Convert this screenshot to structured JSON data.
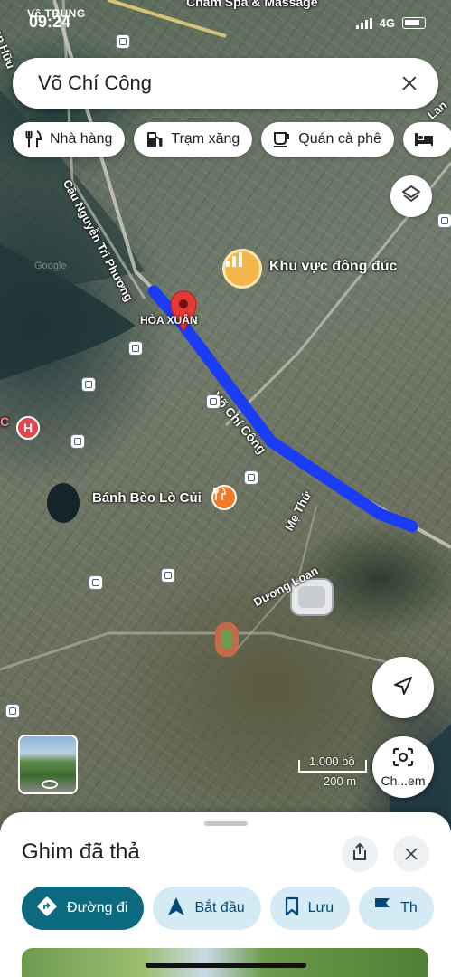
{
  "status_bar": {
    "carrier": "Về TRUNG",
    "time": "09:24",
    "network": "4G"
  },
  "search": {
    "query": "Võ Chí Công"
  },
  "chips": [
    {
      "label": "Nhà hàng",
      "icon": "fork-knife-icon"
    },
    {
      "label": "Trạm xăng",
      "icon": "gas-pump-icon"
    },
    {
      "label": "Quán cà phê",
      "icon": "coffee-icon"
    },
    {
      "label": "",
      "icon": "bed-icon"
    }
  ],
  "map": {
    "top_label": "Chăm Spa & Massage",
    "busy_area": "Khu vực đông đúc",
    "bridge_label": "Cầu Nguyễn Tri Phương",
    "district": "HÒA XUÂN",
    "street_main": "Võ Chí Công",
    "restaurant": "Bánh Bèo Lò Củi",
    "street_me_thu": "Mẹ Thứ",
    "street_duong_loan": "Dương Loan",
    "left_edge_label": "en Hữu",
    "right_edge_label": "Lan",
    "left_c": "C",
    "watermark": "Google",
    "route_color": "#1a3cf5",
    "pin_color": "#e53935"
  },
  "scale": {
    "imperial": "1.000 bộ",
    "metric": "200 m"
  },
  "lens_button": {
    "label": "Ch...em"
  },
  "sheet": {
    "title": "Ghim đã thả",
    "actions": [
      {
        "label": "Đường đi",
        "icon": "directions-icon"
      },
      {
        "label": "Bắt đầu",
        "icon": "navigation-arrow-icon"
      },
      {
        "label": "Lưu",
        "icon": "bookmark-icon"
      },
      {
        "label": "Th",
        "icon": "flag-icon"
      }
    ]
  }
}
